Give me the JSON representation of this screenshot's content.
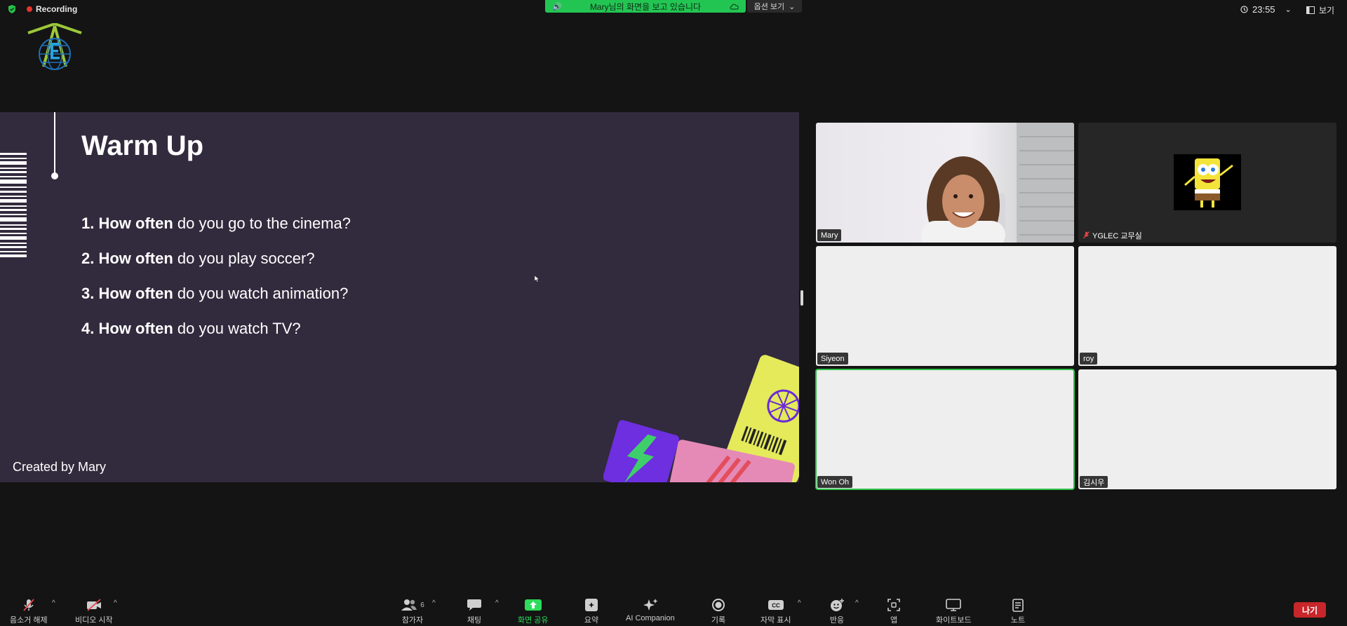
{
  "top_bar": {
    "recording_label": "Recording",
    "share_banner_text": "Mary님의 화면을 보고 있습니다",
    "view_options_label": "옵션 보기",
    "clock": "23:55",
    "view_label": "보기"
  },
  "slide": {
    "title": "Warm Up",
    "questions": [
      {
        "num": "1.",
        "bold": "How often",
        "rest": " do you go to the cinema?"
      },
      {
        "num": "2.",
        "bold": "How often",
        "rest": " do you play soccer?"
      },
      {
        "num": "3.",
        "bold": "How often",
        "rest": " do you watch animation?"
      },
      {
        "num": "4.",
        "bold": "How often",
        "rest": " do you watch TV?"
      }
    ],
    "credit": "Created by Mary"
  },
  "participants": [
    {
      "name": "Mary",
      "muted": false
    },
    {
      "name": "YGLEC 교무실",
      "muted": true
    },
    {
      "name": "Siyeon",
      "muted": false
    },
    {
      "name": "roy",
      "muted": false
    },
    {
      "name": "Won Oh",
      "muted": false,
      "active_speaker": true
    },
    {
      "name": "김시우",
      "muted": false
    }
  ],
  "toolbar": {
    "unmute_label": "음소거 해제",
    "start_video_label": "비디오 시작",
    "participants_label": "참가자",
    "participants_count": "6",
    "chat_label": "채팅",
    "share_screen_label": "화면 공유",
    "summary_label": "요약",
    "ai_companion_label": "AI Companion",
    "record_label": "기록",
    "captions_label": "자막 표시",
    "reactions_label": "반응",
    "apps_label": "앱",
    "whiteboard_label": "화이트보드",
    "notes_label": "노트",
    "leave_label": "나기"
  },
  "colors": {
    "background": "#141414",
    "slide_bg": "#322a3d",
    "share_green": "#23c552",
    "active_speaker": "#2fbf49",
    "leave_red": "#c8262a"
  }
}
